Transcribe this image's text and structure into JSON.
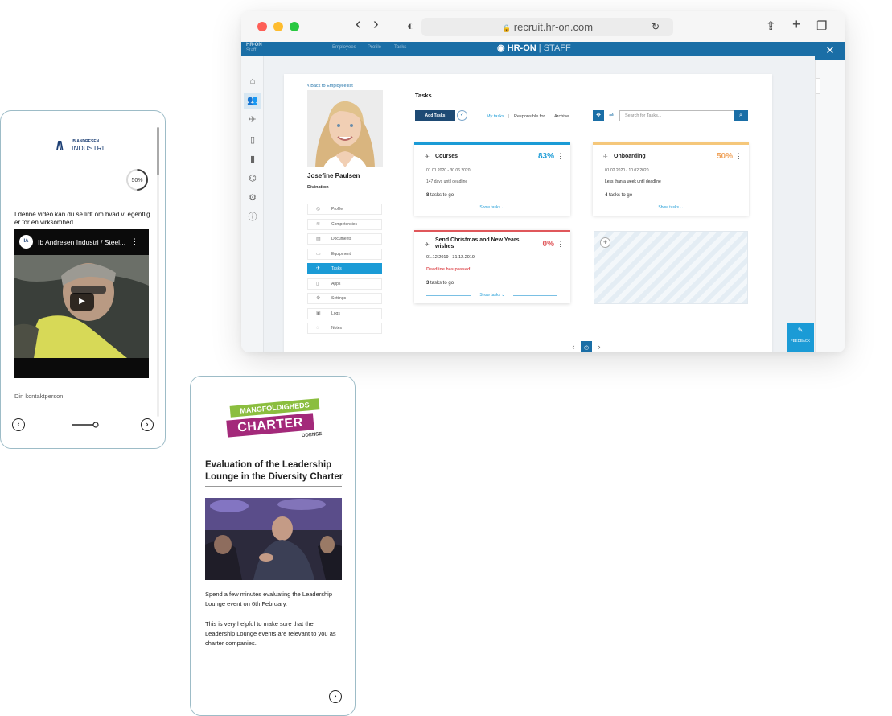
{
  "browser": {
    "url": "recruit.hr-on.com",
    "nav": {
      "back_glyph": "‹",
      "forward_glyph": "›"
    },
    "top_nav": [
      "HR-ON",
      "Staff",
      "Employees",
      "Profile",
      "Tasks"
    ],
    "brand": "HR-ON",
    "brand_suffix": "STAFF",
    "icons": {
      "reload": "↻",
      "share": "⇪",
      "new_tab": "+",
      "tabs": "❐",
      "close": "✕",
      "sidebar": "◐",
      "lock": "🔒"
    }
  },
  "rail": [
    {
      "name": "home-icon",
      "glyph": "⌂"
    },
    {
      "name": "users-icon",
      "glyph": "👥"
    },
    {
      "name": "rocket-icon",
      "glyph": "✈"
    },
    {
      "name": "phone-icon",
      "glyph": "▯"
    },
    {
      "name": "battery-icon",
      "glyph": "▮"
    },
    {
      "name": "education-icon",
      "glyph": "⌬"
    },
    {
      "name": "settings-icon",
      "glyph": "⚙"
    },
    {
      "name": "info-icon",
      "glyph": "ⓘ"
    }
  ],
  "employee": {
    "back_link": "Back to Employee list",
    "name": "Josefine Paulsen",
    "company": "Divination"
  },
  "profile_menu": [
    {
      "label": "Profile",
      "icon": "◎"
    },
    {
      "label": "Competencies",
      "icon": "≋"
    },
    {
      "label": "Documents",
      "icon": "▤"
    },
    {
      "label": "Equipment",
      "icon": "▭"
    },
    {
      "label": "Tasks",
      "icon": "✈"
    },
    {
      "label": "Apps",
      "icon": "▯"
    },
    {
      "label": "Settings",
      "icon": "⚙"
    },
    {
      "label": "Logs",
      "icon": "▣"
    },
    {
      "label": "Notes",
      "icon": "◌"
    }
  ],
  "tasks": {
    "title": "Tasks",
    "add_label": "Add Tasks",
    "filters": [
      "My tasks",
      "|",
      "Responsible for",
      "|",
      "Archive"
    ],
    "search_placeholder": "Search for Tasks...",
    "show_tasks": "Show tasks",
    "cards": [
      {
        "name": "Courses",
        "percent": "83%",
        "dates": "01.01.2020 - 30.06.2020",
        "meta": "147 days until deadline",
        "count": "8",
        "togo": "tasks to go",
        "accent": "#1b9bd6"
      },
      {
        "name": "Onboarding",
        "percent": "50%",
        "dates": "01.02.2020 - 10.02.2020",
        "meta": "Less than a week until deadline",
        "count": "4",
        "togo": "tasks to go",
        "accent": "#f5c77a"
      },
      {
        "name": "Send Christmas and New Years wishes",
        "percent": "0%",
        "dates": "01.12.2019 - 31.12.2019",
        "meta": "Deadline has passed!",
        "count": "3",
        "togo": "tasks to go",
        "accent": "#e0575b"
      }
    ],
    "add_card_glyph": "+"
  },
  "feedback_label": "FEEDBACK",
  "phone1": {
    "logo_top": "IB ANDRESEN",
    "logo_bottom": "INDUSTRI",
    "progress": "50%",
    "progress_fraction": 0.5,
    "intro_text": "I denne video kan du se lidt om hvad vi egentlig er for en virksomhed.",
    "video_title": "Ib Andresen Industri / Steel...",
    "contact_label": "Din kontaktperson"
  },
  "phone2": {
    "logo_line1": "MANGFOLDIGHEDS",
    "logo_line2": "CHARTER",
    "logo_line3": "ODENSE",
    "title": "Evaluation of the Leadership Lounge in the Diversity Charter",
    "paragraph1": "Spend a few minutes evaluating the Leadership Lounge event on 6th February.",
    "paragraph2": "This is very helpful to make sure that the Leadership Lounge events are relevant to you as charter companies."
  },
  "colors": {
    "brand_blue": "#1a6ea6",
    "accent_cyan": "#1b9bd6",
    "danger_red": "#e0575b",
    "warning_orange": "#f0a45d"
  }
}
